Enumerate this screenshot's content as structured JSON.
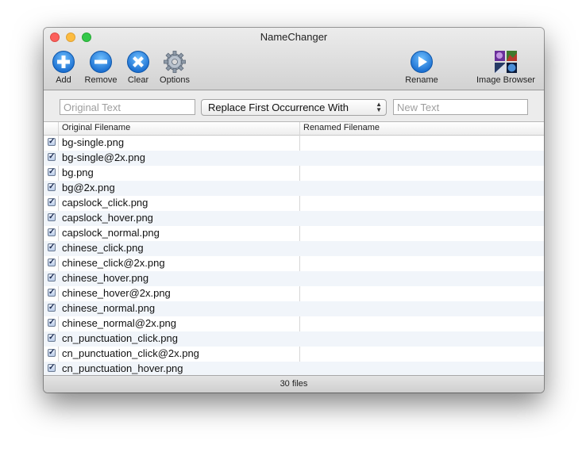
{
  "window": {
    "title": "NameChanger"
  },
  "toolbar": {
    "add": {
      "label": "Add",
      "icon": "plus-circle-icon"
    },
    "remove": {
      "label": "Remove",
      "icon": "minus-circle-icon"
    },
    "clear": {
      "label": "Clear",
      "icon": "x-circle-icon"
    },
    "options": {
      "label": "Options",
      "icon": "gear-icon"
    },
    "rename": {
      "label": "Rename",
      "icon": "play-circle-icon"
    },
    "image_browser": {
      "label": "Image Browser",
      "icon": "photo-grid-icon"
    }
  },
  "fields": {
    "original_placeholder": "Original Text",
    "original_value": "",
    "mode_selected": "Replace First Occurrence With",
    "new_placeholder": "New Text",
    "new_value": ""
  },
  "table": {
    "columns": [
      "Original Filename",
      "Renamed Filename"
    ],
    "rows": [
      {
        "checked": true,
        "original": "bg-single.png",
        "renamed": ""
      },
      {
        "checked": true,
        "original": "bg-single@2x.png",
        "renamed": ""
      },
      {
        "checked": true,
        "original": "bg.png",
        "renamed": ""
      },
      {
        "checked": true,
        "original": "bg@2x.png",
        "renamed": ""
      },
      {
        "checked": true,
        "original": "capslock_click.png",
        "renamed": ""
      },
      {
        "checked": true,
        "original": "capslock_hover.png",
        "renamed": ""
      },
      {
        "checked": true,
        "original": "capslock_normal.png",
        "renamed": ""
      },
      {
        "checked": true,
        "original": "chinese_click.png",
        "renamed": ""
      },
      {
        "checked": true,
        "original": "chinese_click@2x.png",
        "renamed": ""
      },
      {
        "checked": true,
        "original": "chinese_hover.png",
        "renamed": ""
      },
      {
        "checked": true,
        "original": "chinese_hover@2x.png",
        "renamed": ""
      },
      {
        "checked": true,
        "original": "chinese_normal.png",
        "renamed": ""
      },
      {
        "checked": true,
        "original": "chinese_normal@2x.png",
        "renamed": ""
      },
      {
        "checked": true,
        "original": "cn_punctuation_click.png",
        "renamed": ""
      },
      {
        "checked": true,
        "original": "cn_punctuation_click@2x.png",
        "renamed": ""
      },
      {
        "checked": true,
        "original": "cn_punctuation_hover.png",
        "renamed": ""
      }
    ]
  },
  "status": {
    "count_text": "30 files"
  },
  "colors": {
    "accent_blue": "#1e83e0",
    "traffic_close": "#fc605c",
    "traffic_min": "#fdbc40",
    "traffic_max": "#34c84a",
    "row_alt": "#f1f5fa"
  }
}
